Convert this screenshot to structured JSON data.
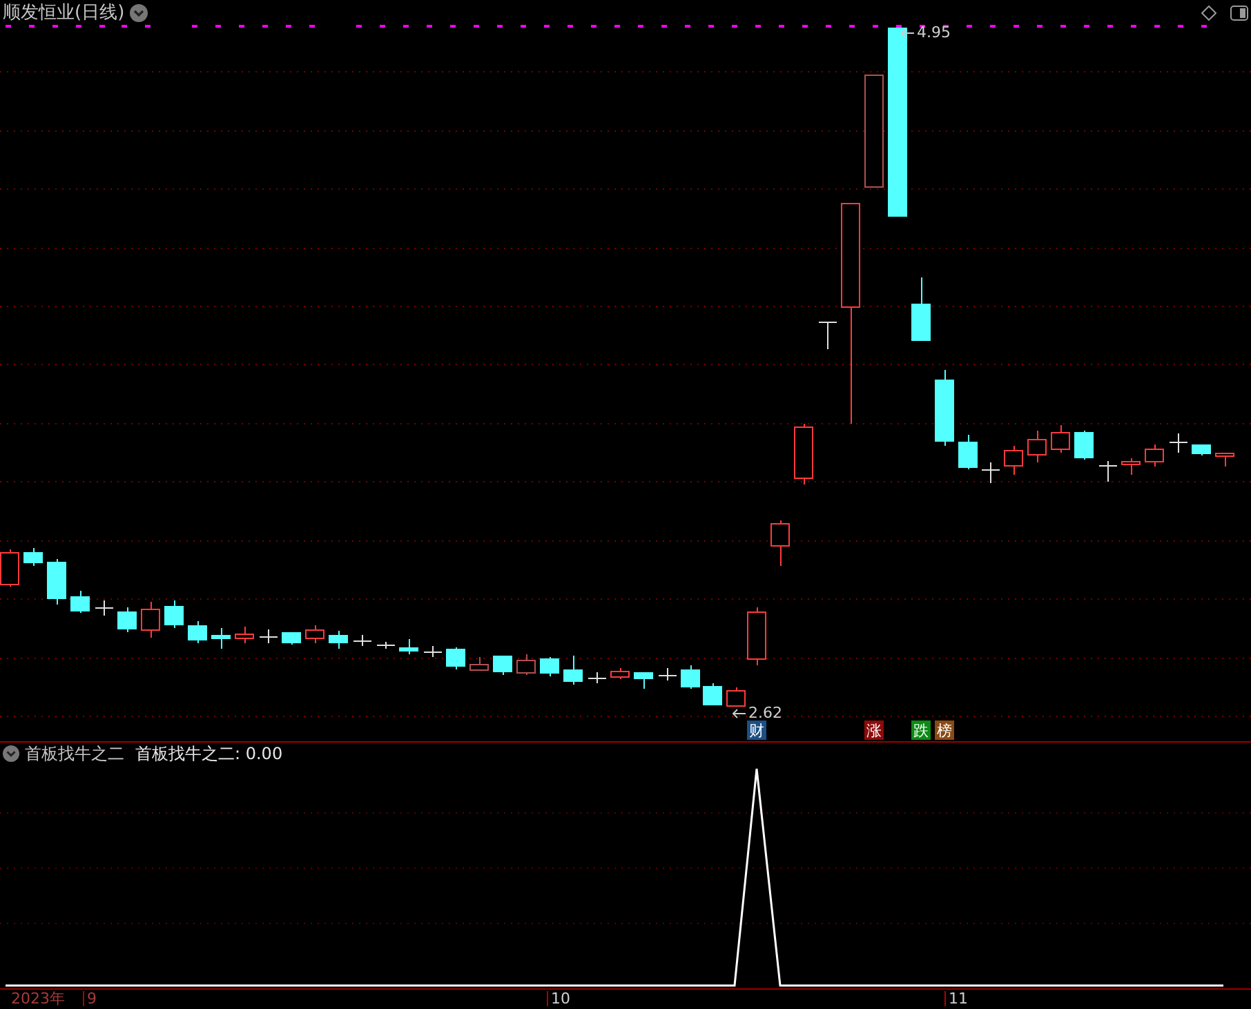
{
  "title": "顺发恒业(日线)",
  "price_labels": {
    "high": "4.95",
    "low": "2.62"
  },
  "news_badges": [
    {
      "label": "财",
      "color": "#1c4f86"
    },
    {
      "label": "涨",
      "color": "#8e0a0a"
    },
    {
      "label": "跌",
      "color": "#0c8a14"
    },
    {
      "label": "榜",
      "color": "#8a4a14"
    }
  ],
  "indicator": {
    "name": "首板找牛之二",
    "reading": "首板找牛之二: 0.00"
  },
  "x_axis": [
    "2023年",
    "9",
    "10",
    "11"
  ]
}
